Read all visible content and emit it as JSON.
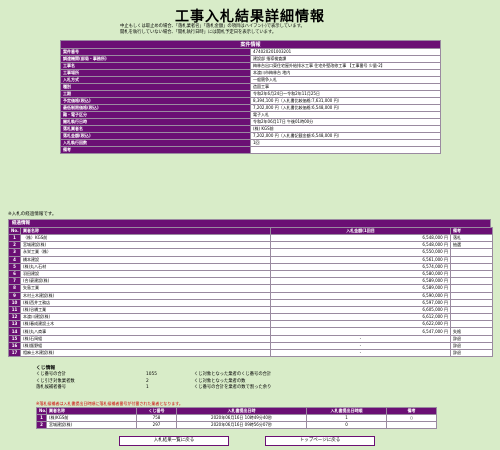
{
  "title": "工事入札結果詳細情報",
  "notes": [
    "中止もしくは取止めの場合、「落札業者名」「落札金額」の項目はハイフン(-)で表示しています。",
    "開札を執行していない場合、「開札執行日時」には開札予定日を表示しています。"
  ],
  "info": {
    "header": "案件情報",
    "rows": [
      {
        "label": "案件番号",
        "value": "474020201003201"
      },
      {
        "label": "調達機関(部局・事務所)",
        "value": "建設部 指導検査課"
      },
      {
        "label": "工事名",
        "value": "梅林台出口東住宅屋外給排水工事 住宅外壁改修工事 【工事番号 少量-2】"
      },
      {
        "label": "工事場所",
        "value": "本渡川市梅林台 地内"
      },
      {
        "label": "入札方式",
        "value": "一般競争入札"
      },
      {
        "label": "種別",
        "value": "造園工事"
      },
      {
        "label": "工期",
        "value": "令和2年6月24日～令和2年11月25日"
      },
      {
        "label": "予定価格(税込)",
        "value": "8,394,100 円（入札書比較価格:7,631,000 円）"
      },
      {
        "label": "最低制限価格(税込)",
        "value": "7,202,000 円（入札書比較価格:6,548,000 円）"
      },
      {
        "label": "難・電子区分",
        "value": "電子入札"
      },
      {
        "label": "開札執行日時",
        "value": "令和2年06月17日 午後01時00分"
      },
      {
        "label": "落札業者名",
        "value": "(株) KGS前"
      },
      {
        "label": "落札金額(税込)",
        "value": "7,202,000 円（入札書記載金額:6,548,000 円）"
      },
      {
        "label": "入札執行回数",
        "value": "1回"
      },
      {
        "label": "備考",
        "value": ""
      }
    ]
  },
  "keii_note": "※入札の経過情報です。",
  "keii": {
    "header": "経過情報",
    "columns": [
      "No.",
      "業者名称",
      "入札金額(1回目",
      "備考"
    ],
    "rows": [
      {
        "no": "1",
        "name": "（株）KGS前",
        "amount": "6,548,000 円",
        "note": "落札"
      },
      {
        "no": "2",
        "name": "宮城建設(株)",
        "amount": "6,548,000 円",
        "note": "抽選"
      },
      {
        "no": "3",
        "name": "永栄工業（株）",
        "amount": "6,550,000 円",
        "note": ""
      },
      {
        "no": "4",
        "name": "橋本建設",
        "amount": "6,561,000 円",
        "note": ""
      },
      {
        "no": "5",
        "name": "(株)丸八石材",
        "amount": "6,574,000 円",
        "note": ""
      },
      {
        "no": "6",
        "name": "羽田建設",
        "amount": "6,580,000 円",
        "note": ""
      },
      {
        "no": "7",
        "name": "(合)豪建設(株)",
        "amount": "6,589,000 円",
        "note": ""
      },
      {
        "no": "8",
        "name": "矢島工業",
        "amount": "6,589,000 円",
        "note": ""
      },
      {
        "no": "9",
        "name": "木村土木建設(株)",
        "amount": "6,590,000 円",
        "note": ""
      },
      {
        "no": "10",
        "name": "(株)西井工務店",
        "amount": "6,597,000 円",
        "note": ""
      },
      {
        "no": "11",
        "name": "(株)谷橋工業",
        "amount": "6,605,000 円",
        "note": ""
      },
      {
        "no": "12",
        "name": "本渡川建設(株)",
        "amount": "6,612,000 円",
        "note": ""
      },
      {
        "no": "13",
        "name": "(株)春成建設土木",
        "amount": "6,622,000 円",
        "note": ""
      },
      {
        "no": "14",
        "name": "(株)丸八商事",
        "amount": "6,547,000 円",
        "note": "失格"
      },
      {
        "no": "15",
        "name": "(株)石岡組",
        "amount": "-",
        "note": "辞退"
      },
      {
        "no": "16",
        "name": "(株)飯野組",
        "amount": "-",
        "note": "辞退"
      },
      {
        "no": "17",
        "name": "相麻土木建設(株)",
        "amount": "-",
        "note": "辞退"
      }
    ]
  },
  "kuji": {
    "title": "くじ情報",
    "rows": [
      {
        "label": "くじ番号の合計",
        "value": "1055",
        "label2": "くじ対象となった業者のくじ番号の合計",
        "value2": ""
      },
      {
        "label": "くじ引き対象業者数",
        "value": "2",
        "label2": "くじ対象となった業者の数",
        "value2": ""
      },
      {
        "label": "落札候補者番号",
        "value": "1",
        "label2": "くじ番号の合計を業者の数で割った余り",
        "value2": ""
      }
    ],
    "warning": "※落札候補者は入札書提出日時順に落札候補者番号が付番された業者となります。",
    "columns": [
      "No.",
      "業者名称",
      "くじ番号",
      "入札書提出日時",
      "入札書提出日時順",
      "備考"
    ],
    "table": [
      {
        "no": "1",
        "name": "(株)KGS前",
        "number": "758",
        "date": "2020年06月16日 10時49分40秒",
        "order": "1",
        "note": "○"
      },
      {
        "no": "2",
        "name": "宮城建設(株)",
        "number": "297",
        "date": "2020年06月16日 09時56分07秒",
        "order": "0",
        "note": ""
      }
    ]
  },
  "buttons": {
    "back": "入札結果一覧に戻る",
    "top": "トップページに戻る"
  }
}
